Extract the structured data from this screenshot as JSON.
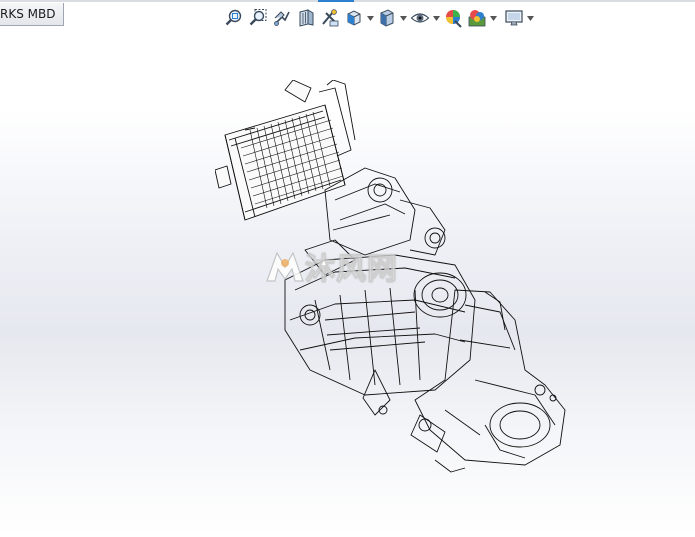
{
  "window": {
    "tab_label": "RKS MBD"
  },
  "toolbar": {
    "items": [
      {
        "icon": "zoom-to-fit-icon"
      },
      {
        "icon": "zoom-to-area-icon"
      },
      {
        "icon": "previous-view-icon"
      },
      {
        "icon": "section-view-icon"
      },
      {
        "icon": "dynamic-annotation-icon"
      },
      {
        "icon": "view-orientation-icon",
        "dropdown": true
      },
      {
        "icon": "display-style-icon",
        "dropdown": true
      },
      {
        "icon": "hide-show-items-icon",
        "dropdown": true
      },
      {
        "icon": "edit-appearance-icon"
      },
      {
        "icon": "apply-scene-icon",
        "dropdown": true
      },
      {
        "icon": "view-settings-icon",
        "dropdown": true
      }
    ]
  },
  "viewport": {
    "watermark_text": "沐风网",
    "model": "wireframe-engine-assembly"
  },
  "colors": {
    "accent": "#2d7fd0",
    "wireframe": "#111111"
  }
}
